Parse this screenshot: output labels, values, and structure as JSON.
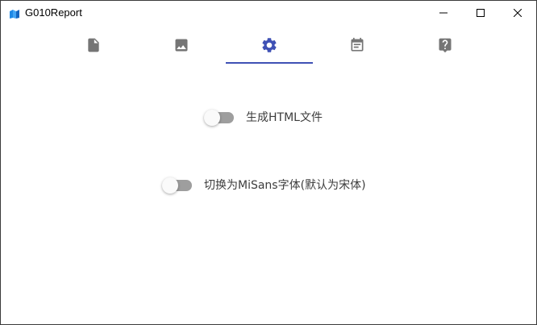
{
  "window": {
    "title": "G010Report",
    "app_icon": "app-logo-icon",
    "controls": [
      "minimize-icon",
      "maximize-icon",
      "close-icon"
    ]
  },
  "tabs": [
    {
      "icon": "file-icon",
      "active": false
    },
    {
      "icon": "image-icon",
      "active": false
    },
    {
      "icon": "gear-icon",
      "active": true
    },
    {
      "icon": "calendar-icon",
      "active": false
    },
    {
      "icon": "help-icon",
      "active": false
    }
  ],
  "colors": {
    "accent": "#3f51b5",
    "tab_icon_inactive": "#757575",
    "toggle_track": "#9e9e9e",
    "toggle_thumb": "#fafafa",
    "label_text": "#3c3c3c"
  },
  "settings": [
    {
      "label": "生成HTML文件",
      "enabled": false
    },
    {
      "label": "切换为MiSans字体(默认为宋体)",
      "enabled": false
    }
  ]
}
